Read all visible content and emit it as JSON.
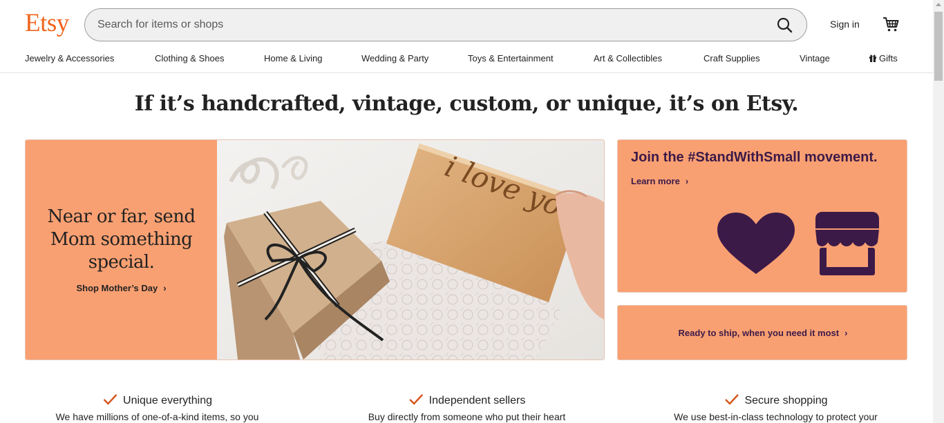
{
  "header": {
    "logo": "Etsy",
    "search_placeholder": "Search for items or shops",
    "signin": "Sign in"
  },
  "nav": {
    "items": [
      "Jewelry & Accessories",
      "Clothing & Shoes",
      "Home & Living",
      "Wedding & Party",
      "Toys & Entertainment",
      "Art & Collectibles",
      "Craft Supplies",
      "Vintage",
      "Gifts"
    ]
  },
  "tagline": "If it’s handcrafted, vintage, custom, or unique, it’s on Etsy.",
  "hero": {
    "heading": "Near or far, send Mom something special.",
    "link": "Shop Mother’s Day",
    "card_text": "i love you mom"
  },
  "cards": {
    "standwithsmall_title": "Join the #StandWithSmall movement.",
    "standwithsmall_link": "Learn more",
    "ready_link": "Ready to ship, when you need it most"
  },
  "values": [
    {
      "title": "Unique everything",
      "desc": "We have millions of one-of-a-kind items, so you"
    },
    {
      "title": "Independent sellers",
      "desc": "Buy directly from someone who put their heart"
    },
    {
      "title": "Secure shopping",
      "desc": "We use best-in-class technology to protect your"
    }
  ],
  "colors": {
    "brand": "#f1641e",
    "promo_bg": "#f9a072",
    "promo_text": "#3c1a48"
  },
  "icons": [
    "search-icon",
    "cart-icon",
    "gift-icon",
    "chevron-right-icon",
    "heart-icon",
    "storefront-icon",
    "checkmark-icon"
  ]
}
